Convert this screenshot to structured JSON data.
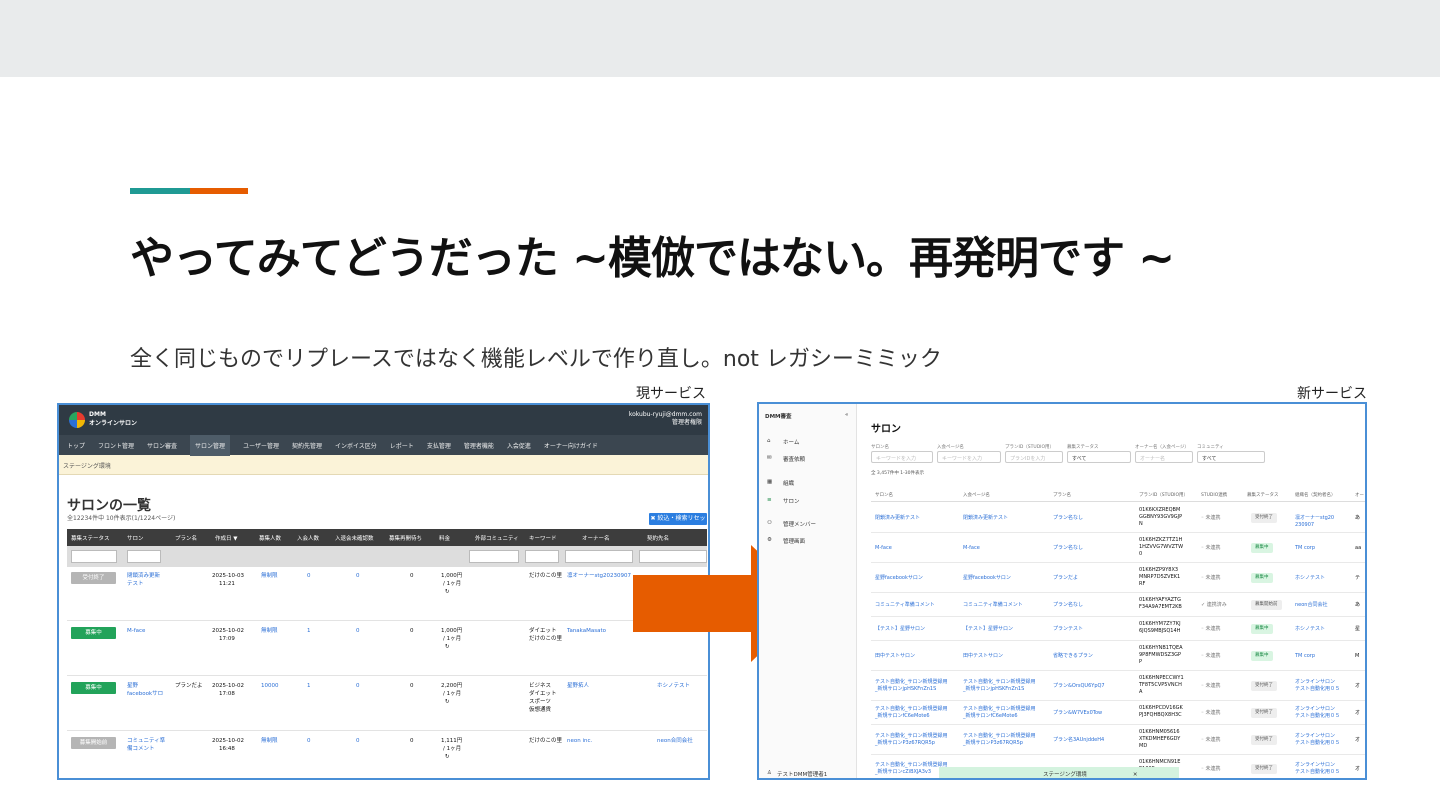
{
  "slide": {
    "title": "やってみてどうだった ~模倣ではない。再発明です ~",
    "subtitle": "全く同じものでリプレースではなく機能レベルで作り直し。not レガシーミミック",
    "caption_old": "現サービス",
    "caption_new": "新サービス",
    "colors": {
      "accent_teal": "#1f9a94",
      "accent_orange": "#e65c00",
      "arrow": "#e65c00"
    }
  },
  "old": {
    "brand_line1": "DMM",
    "brand_line2": "オンラインサロン",
    "user_email": "kokubu-ryuji@dmm.com",
    "user_role": "管理者権限",
    "nav": [
      "トップ",
      "フロント管理",
      "サロン審査",
      "サロン管理",
      "ユーザー管理",
      "契約先管理",
      "インボイス区分",
      "レポート",
      "支払管理",
      "管理者機能",
      "入会促進",
      "オーナー向けガイド"
    ],
    "stage": "ステージング環境",
    "heading": "サロンの一覧",
    "count": "全12234件中 10件表示(1/1224ページ)",
    "reset_button": "✖ 絞込・検索リセット",
    "columns": [
      "募集ステータス",
      "サロン",
      "プラン名",
      "作成日 ▼",
      "募集人数",
      "入会人数",
      "入退会未確認数",
      "募集再開待ち",
      "料金",
      "外部コミュニティ",
      "キーワード",
      "オーナー名",
      "契約先名"
    ],
    "rows": [
      {
        "status": "受付終了",
        "salon": "閉鎖済み更新",
        "salon2": "テスト",
        "plan": "",
        "date": "2025-10-03",
        "time": "11:21",
        "limit": "無制限",
        "members": "0",
        "unconfirmed": "0",
        "waiting": "0",
        "price": "1,000円",
        "price2": "/ 1ヶ月",
        "keyword": "だけのこの里",
        "owner": "凛オーナーstg20230907",
        "contract": ""
      },
      {
        "status": "募集中",
        "salon": "M-face",
        "salon2": "",
        "plan": "",
        "date": "2025-10-02",
        "time": "17:09",
        "limit": "無制限",
        "members": "1",
        "unconfirmed": "0",
        "waiting": "0",
        "price": "1,000円",
        "price2": "/ 1ヶ月",
        "keyword": "ダイエット",
        "owner": "TanakaMasato",
        "contract": ""
      },
      {
        "status": "募集中",
        "salon": "星野",
        "salon2": "facebookサロ",
        "plan": "プランだよ",
        "date": "2025-10-02",
        "time": "17:08",
        "limit": "10000",
        "members": "1",
        "unconfirmed": "0",
        "waiting": "0",
        "price": "2,200円",
        "price2": "/ 1ヶ月",
        "keyword": "ビジネス",
        "owner": "星野拓人",
        "contract": "ホシノテスト"
      },
      {
        "status": "募集開始前",
        "salon": "コミュニティ準",
        "salon2": "備コメント",
        "plan": "",
        "date": "2025-10-02",
        "time": "16:48",
        "limit": "無制限",
        "members": "0",
        "unconfirmed": "0",
        "waiting": "0",
        "price": "1,111円",
        "price2": "/ 1ヶ月",
        "keyword": "だけのこの里",
        "owner": "neon inc.",
        "contract": "neon合同会社"
      }
    ],
    "keyword_row2_line2": "だけのこの里",
    "keyword_row3_line2": "ダイエット",
    "keyword_row3_line3": "スポーツ",
    "keyword_row3_line4": "仮想通貨"
  },
  "new": {
    "brand": "DMM審査",
    "sidebar": [
      "ホーム",
      "審査依頼",
      "組織",
      "サロン",
      "管理メンバー",
      "管理画面"
    ],
    "user": "テストDMM管理者1",
    "title": "サロン",
    "filter_labels": [
      "サロン名",
      "入会ページ名",
      "プランID（STUDIO用）",
      "募集ステータス",
      "オーナー名（入会ページ）",
      "コミュニティ"
    ],
    "filter_placeholders": [
      "キーワードを入力",
      "キーワードを入力",
      "プランIDを入力",
      "すべて",
      "オーナー名",
      "すべて"
    ],
    "count": "全 3,457件中 1-30件表示",
    "columns": [
      "サロン名",
      "入会ページ名",
      "プラン名",
      "プランID（STUDIO用）",
      "STUDIO連携",
      "募集ステータス",
      "組織名（契約者名）",
      "オー"
    ],
    "rows": [
      {
        "salon": "閉鎖済み更新テスト",
        "page": "閉鎖済み更新テスト",
        "plan": "プラン名なし",
        "id": "01K6KXZREQBM",
        "id2": "GGBNY93GV9GJP",
        "id3": "N",
        "studio": "未連携",
        "status": "受付終了",
        "org": "凛オーナーstg20",
        "org2": "230907",
        "owner": "あ"
      },
      {
        "salon": "M-face",
        "page": "M-face",
        "plan": "プラン名なし",
        "id": "01K6HZKZ7TZ1H",
        "id2": "1HZVVG7WVZTW",
        "id3": "0",
        "studio": "未連携",
        "status": "募集中",
        "org": "TM corp",
        "org2": "",
        "owner": "aa"
      },
      {
        "salon": "星野facebookサロン",
        "page": "星野facebookサロン",
        "plan": "プランだよ",
        "id": "01K6HZP9Y8X3",
        "id2": "MNRP7D5ZVEK1",
        "id3": "RF",
        "studio": "未連携",
        "status": "募集中",
        "org": "ホシノテスト",
        "org2": "",
        "owner": "テ"
      },
      {
        "salon": "コミュニティ準備コメント",
        "page": "コミュニティ準備コメント",
        "plan": "プラン名なし",
        "id": "01K6HYAFYAZTG",
        "id2": "F34A9A7EMT2KB",
        "id3": "",
        "studio": "連携済み",
        "status": "募集開始前",
        "org": "neon合同会社",
        "org2": "",
        "owner": "あ"
      },
      {
        "salon": "【テスト】星野サロン",
        "page": "【テスト】星野サロン",
        "plan": "プランテスト",
        "id": "01K6HYM7ZY7KJ",
        "id2": "6JQS9MBJSQ14H",
        "id3": "",
        "studio": "未連携",
        "status": "募集中",
        "org": "ホシノテスト",
        "org2": "",
        "owner": "星"
      },
      {
        "salon": "田中テストサロン",
        "page": "田中テストサロン",
        "plan": "省略できるプラン",
        "id": "01K6HYNB1TQEA",
        "id2": "9P8FMWDSZ3GP",
        "id3": "P",
        "studio": "未連携",
        "status": "募集中",
        "org": "TM corp",
        "org2": "",
        "owner": "M"
      },
      {
        "salon": "テスト自動化_サロン新規登録用",
        "salon2": "_新規サロンjpHSKFnZn1S",
        "page": "テスト自動化_サロン新規登録用",
        "page2": "_新規サロンjpHSKFnZn1S",
        "plan": "プラン&OrsQU6YpQ7",
        "id": "01K6HNPECCWY1",
        "id2": "TF8T5CVP5VNCH",
        "id3": "A",
        "studio": "未連携",
        "status": "受付終了",
        "org": "オンラインサロン",
        "org2": "テスト自動化用０５",
        "owner": "オ"
      },
      {
        "salon": "テスト自動化_サロン新規登録用",
        "salon2": "_新規サロンfC6eMote6",
        "page": "テスト自動化_サロン新規登録用",
        "page2": "_新規サロンfC6eMote6",
        "plan": "プラン&W7VEx0Tow",
        "id": "01K6HPCDV16GK",
        "id2": "PJ3FQHBQX8H3C",
        "id3": "",
        "studio": "未連携",
        "status": "受付終了",
        "org": "オンラインサロン",
        "org2": "テスト自動化用０５",
        "owner": "オ"
      },
      {
        "salon": "テスト自動化_サロン新規登録用",
        "salon2": "_新規サロンP3z67RQR5p",
        "page": "テスト自動化_サロン新規登録用",
        "page2": "_新規サロンP3z67RQR5p",
        "plan": "プラン名3AUnjddeH4",
        "id": "01K6HNM05616",
        "id2": "XTKDMHEF6GDY",
        "id3": "MD",
        "studio": "未連携",
        "status": "受付終了",
        "org": "オンラインサロン",
        "org2": "テスト自動化用０５",
        "owner": "オ"
      },
      {
        "salon": "テスト自動化_サロン新規登録用",
        "salon2": "_新規サロンcZiBXJA3v3",
        "page": "",
        "page2": "",
        "plan": "",
        "id": "01K6HNMCN91E",
        "id2": "E100F",
        "id3": "",
        "studio": "未連携",
        "status": "受付終了",
        "org": "オンラインサロン",
        "org2": "テスト自動化用０５",
        "owner": "オ"
      }
    ],
    "stage_toast": "ステージング環境",
    "toast_close": "✕"
  }
}
